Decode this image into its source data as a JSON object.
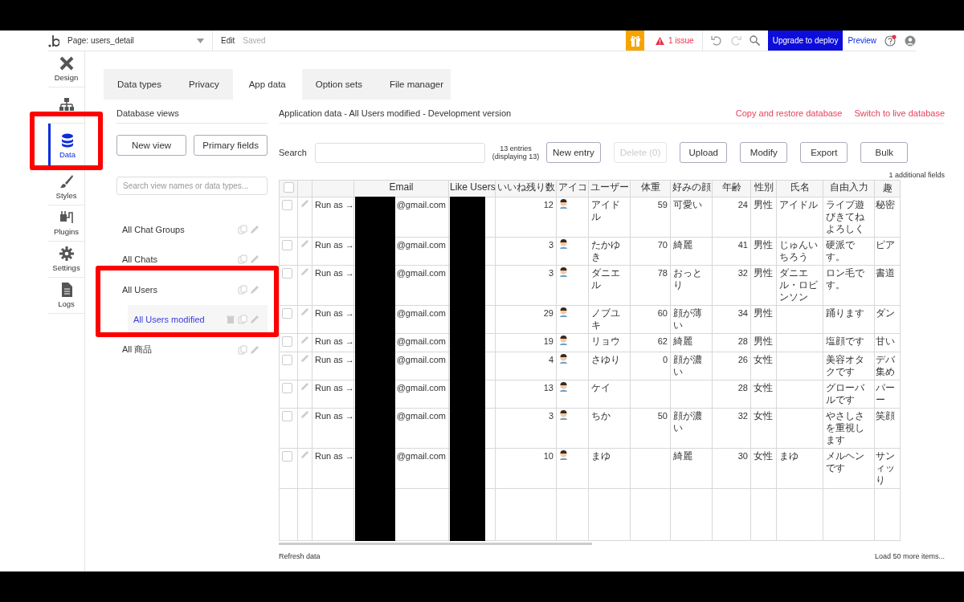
{
  "topbar": {
    "page_selector": "Page: users_detail",
    "edit_label": "Edit",
    "save_status": "Saved",
    "issues": "1 issue",
    "upgrade_button": "Upgrade to deploy",
    "preview_link": "Preview"
  },
  "sidebar": {
    "items": [
      {
        "label": "Design",
        "kind": "design",
        "selected": false
      },
      {
        "kind": "workflow",
        "selected": false
      },
      {
        "label": "Data",
        "kind": "data",
        "selected": true
      },
      {
        "label": "Styles",
        "kind": "styles",
        "selected": false
      },
      {
        "label": "Plugins",
        "kind": "plugins",
        "selected": false
      },
      {
        "label": "Settings",
        "kind": "settings",
        "selected": false
      },
      {
        "label": "Logs",
        "kind": "logs",
        "selected": false
      }
    ]
  },
  "tabs": [
    {
      "label": "Data types",
      "selected": false
    },
    {
      "label": "Privacy",
      "selected": false
    },
    {
      "label": "App data",
      "selected": true
    },
    {
      "label": "Option sets",
      "selected": false
    },
    {
      "label": "File manager",
      "selected": false
    }
  ],
  "views_panel": {
    "title": "Database views",
    "buttons": [
      "New view",
      "Primary fields"
    ],
    "search": {
      "placeholder": "Search view names or data types..."
    },
    "views": [
      {
        "label": "All Chat Groups",
        "selected": false
      },
      {
        "label": "All Chats",
        "selected": false
      },
      {
        "label": "All Users",
        "selected": false,
        "children": [
          {
            "label": "All Users modified",
            "selected": true,
            "deletable": true
          }
        ]
      },
      {
        "label": "All 商品",
        "selected": false
      }
    ]
  },
  "data_panel": {
    "title": "Application data - All Users modified - Development version",
    "links": [
      "Copy and restore database",
      "Switch to live database"
    ],
    "search_label": "Search",
    "entries": "13 entries",
    "displaying": "(displaying 13)",
    "buttons": [
      {
        "label": "New entry",
        "disabled": false
      },
      {
        "label": "Delete (0)",
        "disabled": true
      },
      {
        "label": "Upload",
        "disabled": false
      },
      {
        "label": "Modify",
        "disabled": false
      },
      {
        "label": "Export",
        "disabled": false
      },
      {
        "label": "Bulk",
        "disabled": false
      }
    ],
    "additional_fields": "1 additional fields",
    "table": {
      "header_checked": false,
      "columns": [
        "Email",
        "Like Users",
        "いいね残り数",
        "アイコ",
        "ユーザー",
        "体重",
        "好みの顔",
        "年齢",
        "性別",
        "氏名",
        "自由入力",
        "趣"
      ],
      "rows": [
        {
          "checked": false,
          "run_as": "Run as →",
          "email": "@gmail.com",
          "likes": "12",
          "username": "アイドル",
          "weight": "59",
          "face": "可愛い",
          "age": "24",
          "gender": "男性",
          "full_name": "アイドル",
          "free_text": "ライブ遊びきてねよろしく",
          "column_13": "秘密"
        },
        {
          "checked": false,
          "run_as": "Run as →",
          "email": "@gmail.com",
          "likes": "3",
          "username": "たかゆき",
          "weight": "70",
          "face": "綺麗",
          "age": "41",
          "gender": "男性",
          "full_name": "じゅんいちろう",
          "free_text": "硬派です。",
          "column_13": "ピア"
        },
        {
          "checked": false,
          "run_as": "Run as →",
          "email": "@gmail.com",
          "likes": "3",
          "username": "ダニエル",
          "weight": "78",
          "face": "おっとり",
          "age": "32",
          "gender": "男性",
          "full_name": "ダニエル・ロビンソン",
          "free_text": "ロン毛です。",
          "column_13": "書道"
        },
        {
          "checked": false,
          "run_as": "Run as →",
          "email": "@gmail.com",
          "likes": "29",
          "username": "ノブユキ",
          "weight": "60",
          "face": "顔が薄い",
          "age": "34",
          "gender": "男性",
          "free_text": "踊ります",
          "column_13": "ダン"
        },
        {
          "checked": false,
          "run_as": "Run as →",
          "email": "@gmail.com",
          "likes": "19",
          "username": "リョウ",
          "weight": "62",
          "face": "綺麗",
          "age": "28",
          "gender": "男性",
          "free_text": "塩顔です",
          "column_13": "甘い"
        },
        {
          "checked": false,
          "run_as": "Run as →",
          "email": "@gmail.com",
          "likes": "4",
          "username": "さゆり",
          "weight": "0",
          "face": "顔が濃い",
          "age": "26",
          "gender": "女性",
          "free_text": "美容オタクです",
          "column_13": "デバ集め"
        },
        {
          "checked": false,
          "run_as": "Run as →",
          "email": "@gmail.com",
          "likes": "13",
          "username": "ケイ",
          "age": "28",
          "gender": "女性",
          "free_text": "グローバルです",
          "column_13": "パーー"
        },
        {
          "checked": false,
          "run_as": "Run as →",
          "email": "@gmail.com",
          "likes": "3",
          "username": "ちか",
          "weight": "50",
          "face": "顔が濃い",
          "age": "32",
          "gender": "女性",
          "free_text": "やさしさを重視します",
          "column_13": "笑顔"
        },
        {
          "checked": false,
          "run_as": "Run as →",
          "email": "@gmail.com",
          "likes": "10",
          "username": "まゆ",
          "face": "綺麗",
          "age": "30",
          "gender": "女性",
          "full_name": "まゆ",
          "free_text": "メルヘンです",
          "column_13": "サンィッり"
        }
      ]
    },
    "refresh_link": "Refresh data",
    "load_more_link": "Load 50 more items..."
  }
}
